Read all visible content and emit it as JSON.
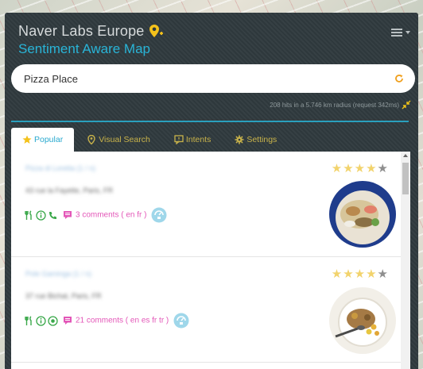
{
  "header": {
    "title": "Naver Labs Europe",
    "subtitle": "Sentiment Aware Map"
  },
  "search": {
    "value": "Pizza Place"
  },
  "hits": "208 hits in a 5.746 km radius (request 342ms)",
  "tabs": [
    {
      "label": "Popular",
      "icon": "star-icon"
    },
    {
      "label": "Visual Search",
      "icon": "pin-icon"
    },
    {
      "label": "Intents",
      "icon": "message-icon"
    },
    {
      "label": "Settings",
      "icon": "gear-icon"
    }
  ],
  "results": [
    {
      "name": "Pizza di Loretta (1 / n)",
      "address": "43 rue la Fayette, Paris, FR",
      "rating": 4,
      "max_rating": 5,
      "comments": "3 comments ( en fr )"
    },
    {
      "name": "Pole Gaminga (1 / n)",
      "address": "37 rue Bichat, Paris, FR",
      "rating": 4,
      "max_rating": 5,
      "comments": "21 comments ( en es fr tr )"
    }
  ],
  "colors": {
    "accent": "#29b4d7",
    "panel": "#2f3a3e",
    "gold": "#c8b24a",
    "comment": "#e357b8",
    "feature_green": "#3aa84a"
  }
}
